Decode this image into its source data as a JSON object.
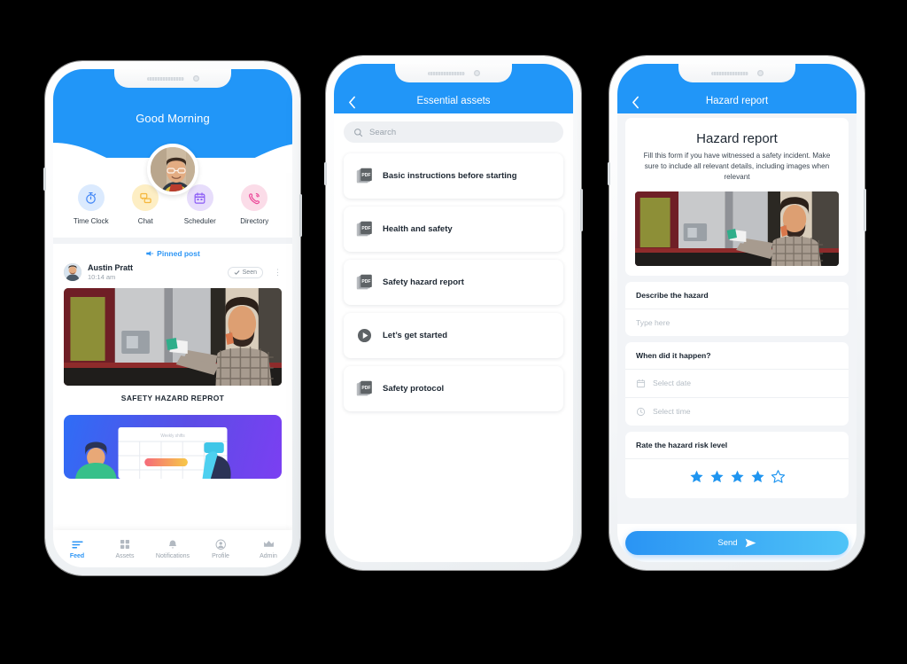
{
  "phones": [
    {
      "name": "feed-screen",
      "greeting": "Good Morning",
      "avatar_icon": "user-avatar",
      "quick_actions": [
        {
          "label": "Time Clock",
          "icon": "stopwatch-icon",
          "bg": "#dbeafe",
          "fg": "#3b82f6"
        },
        {
          "label": "Chat",
          "icon": "chat-bubbles-icon",
          "bg": "#fdeec4",
          "fg": "#f5b73d"
        },
        {
          "label": "Scheduler",
          "icon": "calendar-icon",
          "bg": "#e7ddfb",
          "fg": "#8b5cf6"
        },
        {
          "label": "Directory",
          "icon": "phone-ring-icon",
          "bg": "#fbdce8",
          "fg": "#ec4899"
        }
      ],
      "pinned_label": "Pinned post",
      "pin_icon": "pin-icon",
      "post": {
        "author": "Austin Pratt",
        "time": "10:14 am",
        "seen_label": "Seen",
        "seen_icon": "check-icon",
        "more_icon": "kebab-menu-icon",
        "caption": "SAFETY HAZARD REPROT",
        "image_icon": "worker-photo"
      },
      "second_card": {
        "icon": "weekly-shifts-illustration",
        "caption": "Weekly shifts"
      },
      "bottom_nav": [
        {
          "label": "Feed",
          "icon": "feed-icon",
          "active": true
        },
        {
          "label": "Assets",
          "icon": "grid-icon",
          "active": false
        },
        {
          "label": "Notifications",
          "icon": "bell-icon",
          "active": false
        },
        {
          "label": "Profile",
          "icon": "profile-icon",
          "active": false
        },
        {
          "label": "Admin",
          "icon": "crown-icon",
          "active": false
        }
      ]
    },
    {
      "name": "essential-assets-screen",
      "bar_title": "Essential assets",
      "back_icon": "chevron-left-icon",
      "search": {
        "placeholder": "Search",
        "icon": "search-icon",
        "value": ""
      },
      "assets": [
        {
          "label": "Basic instructions before starting",
          "icon": "pdf-icon"
        },
        {
          "label": "Health and safety",
          "icon": "pdf-icon"
        },
        {
          "label": "Safety hazard report",
          "icon": "pdf-icon"
        },
        {
          "label": "Let’s get started",
          "icon": "play-icon"
        },
        {
          "label": "Safety protocol",
          "icon": "pdf-icon"
        }
      ]
    },
    {
      "name": "hazard-report-screen",
      "bar_title": "Hazard report",
      "back_icon": "chevron-left-icon",
      "form_title": "Hazard report",
      "form_subtitle": "Fill this form if you have witnessed a safety incident. Make sure to include all relevant details, including images when relevant",
      "image_icon": "worker-photo",
      "fields": [
        {
          "question": "Describe the  hazard",
          "placeholder": "Type here",
          "icon": ""
        },
        {
          "question": "When did it happen?",
          "placeholder": "Select date",
          "icon": "calendar-icon"
        },
        {
          "question": "",
          "placeholder": "Select time",
          "icon": "clock-icon"
        },
        {
          "question": "Rate the hazard risk level",
          "placeholder": "",
          "icon": ""
        }
      ],
      "rating": {
        "value": 4,
        "max": 5,
        "icon": "star-icon"
      },
      "send": {
        "label": "Send",
        "icon": "send-arrow-icon"
      }
    }
  ],
  "colors": {
    "brand_blue": "#2196f8",
    "accent_blue": "#2e96f5",
    "page_bg": "#000000",
    "card_bg": "#ffffff",
    "muted_text": "#9aa3ac"
  }
}
